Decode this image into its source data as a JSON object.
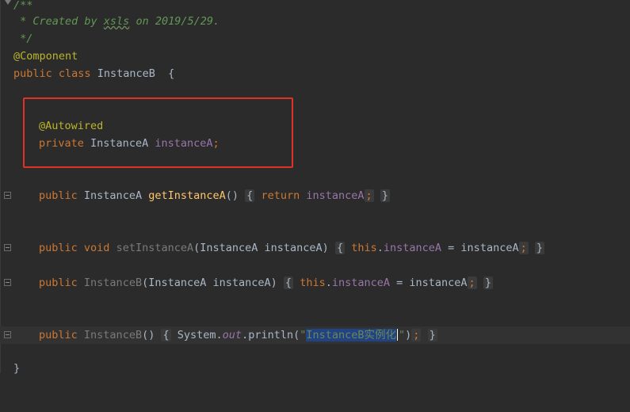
{
  "comment": {
    "open": "/**",
    "prefix": " * Created by ",
    "author": "xsls",
    "suffix": " on 2019/5/29.",
    "close": " */"
  },
  "annotation_component": "@Component",
  "class_decl": {
    "kw_public": "public",
    "kw_class": "class",
    "name": "InstanceB",
    "brace": "  {"
  },
  "field": {
    "annotation": "@Autowired",
    "kw_private": "private",
    "type": "InstanceA",
    "name": "instanceA",
    "semi": ";"
  },
  "getter": {
    "kw_public": "public",
    "type": "InstanceA",
    "name": "getInstanceA",
    "parens": "()",
    "open": "{",
    "kw_return": "return",
    "field": "instanceA",
    "semi": ";",
    "close": "}"
  },
  "setter": {
    "kw_public": "public",
    "kw_void": "void",
    "name": "setInstanceA",
    "params_open": "(InstanceA instanceA)",
    "open": "{",
    "kw_this": "this",
    "dot": ".",
    "field": "instanceA",
    "assign": " = instanceA",
    "semi": ";",
    "close": "}"
  },
  "ctor1": {
    "kw_public": "public",
    "name": "InstanceB",
    "params": "(InstanceA instanceA)",
    "open": "{",
    "kw_this": "this",
    "dot": ".",
    "field": "instanceA",
    "assign": " = instanceA",
    "semi": ";",
    "close": "}"
  },
  "ctor2": {
    "kw_public": "public",
    "name": "InstanceB",
    "parens": "()",
    "open": "{",
    "system": "System.",
    "out": "out",
    "println": ".println(",
    "quote_open": "\"",
    "string_selected": "InstanceB实例化",
    "quote_close": "\"",
    "close_paren": ")",
    "semi": ";",
    "close": "}"
  },
  "class_close": "}",
  "colors": {
    "background": "#2b2b2b",
    "keyword": "#cc7832",
    "comment": "#629755",
    "annotation": "#bbb529",
    "field": "#9876aa",
    "method": "#ffc66d",
    "string": "#6a8759",
    "highlight_box": "#e0302a",
    "selection": "#214283"
  }
}
